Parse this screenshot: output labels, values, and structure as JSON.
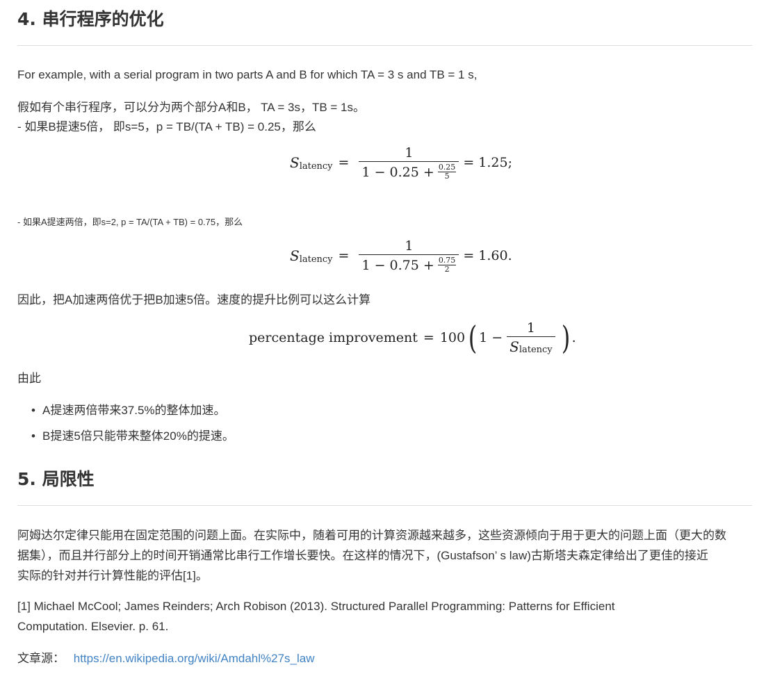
{
  "section4": {
    "heading": "4. 串行程序的优化",
    "intro_en": "For example, with a serial program in two parts A and B for which TA = 3 s and TB = 1 s,",
    "intro_zh": "假如有个串行程序，可以分为两个部分A和B， TA = 3s，TB = 1s。",
    "case_b": "- 如果B提速5倍， 即s=5，p = TB/(TA + TB) = 0.25，那么",
    "formula1": {
      "lhs_symbol": "S",
      "lhs_sub": "latency",
      "eq": "=",
      "numerator": "1",
      "den_main": "1 − 0.25 +",
      "den_frac_num": "0.25",
      "den_frac_den": "5",
      "result": "= 1.25;"
    },
    "case_a": "- 如果A提速两倍，即s=2, p = TA/(TA + TB) = 0.75，那么",
    "formula2": {
      "lhs_symbol": "S",
      "lhs_sub": "latency",
      "eq": "=",
      "numerator": "1",
      "den_main": "1 − 0.75 +",
      "den_frac_num": "0.75",
      "den_frac_den": "2",
      "result": "= 1.60."
    },
    "conclusion": "因此，把A加速两倍优于把B加速5倍。速度的提升比例可以这么计算",
    "formula3": {
      "lhs": "percentage improvement",
      "eq": "=",
      "factor": "100",
      "open_paren": "(",
      "one_minus": "1 −",
      "numerator": "1",
      "den_symbol": "S",
      "den_sub": "latency",
      "close_paren": ")",
      "period": "."
    },
    "hence": "由此",
    "bullets": [
      "A提速两倍带来37.5%的整体加速。",
      "B提速5倍只能带来整体20%的提速。"
    ]
  },
  "section5": {
    "heading": "5. 局限性",
    "paragraph_lines": [
      "阿姆达尔定律只能用在固定范围的问题上面。在实际中，随着可用的计算资源越来越多，这些资源倾向于用于更大的问题上面（更大的数",
      "据集），而且并行部分上的时间开销通常比串行工作增长要快。在这样的情况下，(Gustafson’ s law)古斯塔夫森定律给出了更佳的接近",
      "实际的针对并行计算性能的评估[1]。"
    ],
    "reference_lines": [
      "[1] Michael McCool; James Reinders; Arch Robison (2013). Structured Parallel Programming: Patterns for Efficient",
      "Computation. Elsevier. p. 61."
    ],
    "source_label": "文章源：",
    "source_link": "https://en.wikipedia.org/wiki/Amdahl%27s_law"
  },
  "colors": {
    "text": "#333333",
    "rule": "#dddddd",
    "link": "#4183c4"
  }
}
